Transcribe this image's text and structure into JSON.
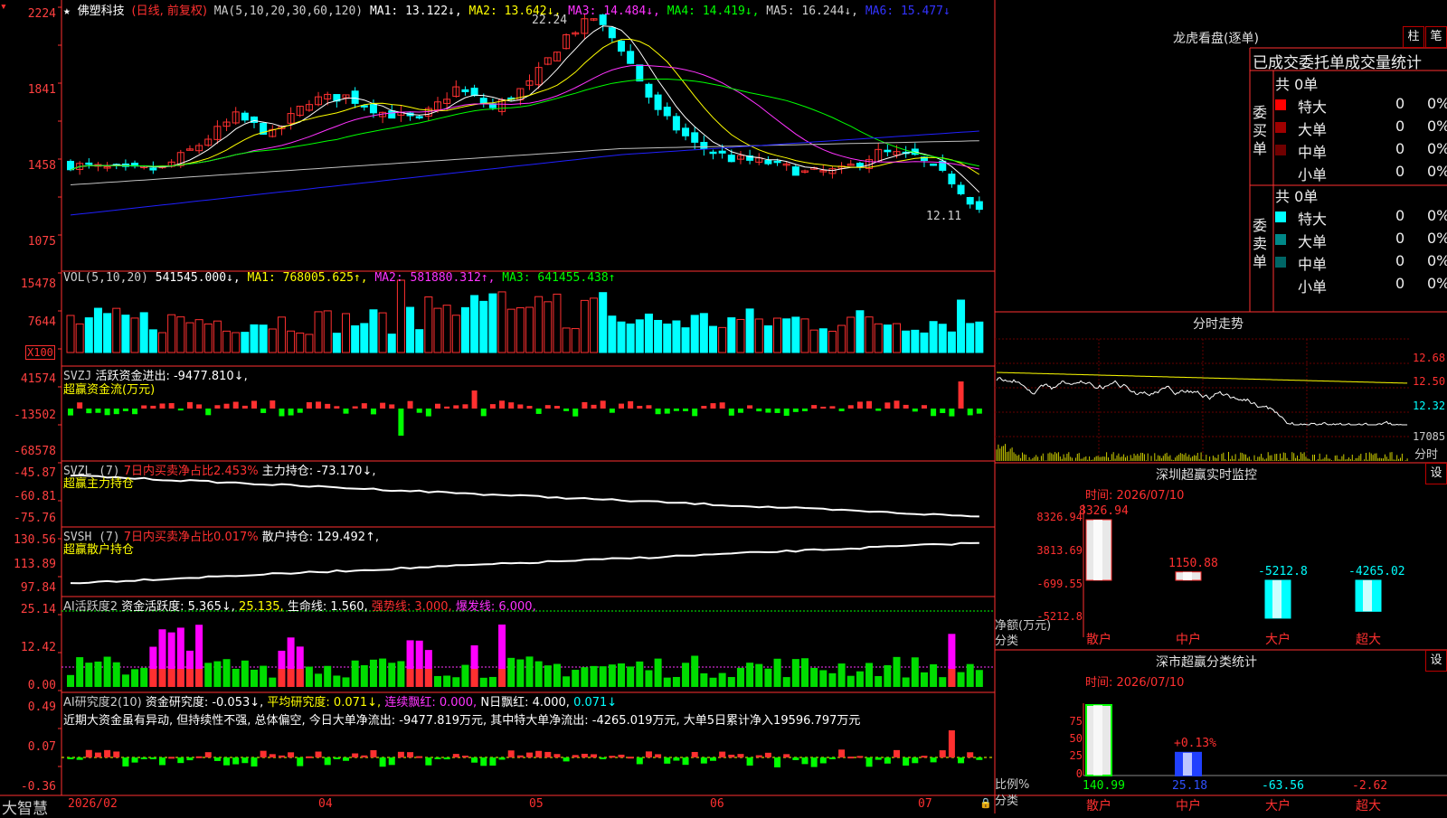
{
  "colors": {
    "up": "#ff3030",
    "down": "#00ffff",
    "ma1": "#ffffff",
    "ma2": "#ffff00",
    "ma3": "#ff33ff",
    "ma4": "#00ff00",
    "ma5": "#c0c0c0",
    "ma6": "#2020ff",
    "axis": "#ff3030",
    "bg": "#000000"
  },
  "header": {
    "star": "★",
    "stock": "佛塑科技",
    "mode": "(日线, 前复权)",
    "ma_label": "MA(5,10,20,30,60,120)",
    "ma1": "MA1: 13.122↓,",
    "ma2": "MA2: 13.642↓,",
    "ma3": "MA3: 14.484↓,",
    "ma4": "MA4: 14.419↓,",
    "ma5": "MA5: 16.244↓,",
    "ma6": "MA6: 15.477↓"
  },
  "main_axis": {
    "labels": [
      "2224",
      "1841",
      "1458",
      "1075"
    ],
    "high_mark": "22.24",
    "low_mark": "12.11"
  },
  "volume": {
    "title": "VOL(5,10,20)",
    "value": "541545.000↓,",
    "ma1": "MA1: 768005.625↑,",
    "ma2": "MA2: 581880.312↑,",
    "ma3": "MA3: 641455.438↑",
    "axis": [
      "15478",
      "7644"
    ],
    "unit": "X100"
  },
  "svzj": {
    "title": "SVZJ",
    "label": "活跃资金进出: -9477.810↓,",
    "sub": "超赢资金流(万元)",
    "axis": [
      "41574",
      "-13502",
      "-68578"
    ]
  },
  "svzl": {
    "title": "SVZL (7)",
    "ratio": "7日内买卖净占比2.453%",
    "hold": "主力持仓: -73.170↓,",
    "sub": "超赢主力持仓",
    "axis": [
      "-45.87",
      "-60.81",
      "-75.76"
    ]
  },
  "svsh": {
    "title": "SVSH (7)",
    "ratio": "7日内买卖净占比0.017%",
    "hold": "散户持仓: 129.492↑,",
    "sub": "超赢散户持仓",
    "axis": [
      "130.56",
      "113.89",
      "97.84"
    ]
  },
  "ai_act": {
    "title": "AI活跃度2",
    "act": "资金活跃度: 5.365↓,",
    "v2": "25.135,",
    "life": "生命线: 1.560,",
    "strong": "强势线: 3.000,",
    "burst": "爆发线: 6.000,",
    "axis": [
      "25.14",
      "12.42",
      "0.00"
    ]
  },
  "ai_res": {
    "title": "AI研究度2(10)",
    "res": "资金研究度: -0.053↓,",
    "avg": "平均研究度: 0.071↓,",
    "cont": "连续飘红: 0.000,",
    "n": "N日飘红: 4.000,",
    "last": "0.071↓",
    "axis": [
      "0.49",
      "0.07",
      "-0.36"
    ],
    "comment": "近期大资金虽有异动, 但持续性不强, 总体偏空, 今日大单净流出: -9477.819万元, 其中特大单净流出: -4265.019万元, 大单5日累计净入19596.797万元"
  },
  "bottom": {
    "brand": "大智慧",
    "dates": [
      "2026/02",
      "04",
      "05",
      "06",
      "07"
    ]
  },
  "lhb": {
    "title": "龙虎看盘(逐单)",
    "btn1": "柱",
    "btn2": "笔",
    "sub": "已成交委托单成交量统计",
    "buy_label": "委买单",
    "sell_label": "委卖单",
    "buy_total": "共 0单",
    "sell_total": "共 0单",
    "rows_buy": [
      {
        "name": "特大",
        "v": "0",
        "p": "0%",
        "c": "#ff0000"
      },
      {
        "name": "大单",
        "v": "0",
        "p": "0%",
        "c": "#a00000"
      },
      {
        "name": "中单",
        "v": "0",
        "p": "0%",
        "c": "#700000"
      },
      {
        "name": "小单",
        "v": "0",
        "p": "0%",
        "c": "#000000"
      }
    ],
    "rows_sell": [
      {
        "name": "特大",
        "v": "0",
        "p": "0%",
        "c": "#00ffff"
      },
      {
        "name": "大单",
        "v": "0",
        "p": "0%",
        "c": "#008888"
      },
      {
        "name": "中单",
        "v": "0",
        "p": "0%",
        "c": "#006666"
      },
      {
        "name": "小单",
        "v": "0",
        "p": "0%",
        "c": "#000000"
      }
    ]
  },
  "intraday": {
    "title": "分时走势",
    "axis": [
      "12.68",
      "12.50",
      "12.32"
    ],
    "vol": "17085",
    "vol_unit": "分时"
  },
  "sz_monitor": {
    "title": "深圳超赢实时监控",
    "btn": "设",
    "time": "时间: 2026/07/10",
    "axis": [
      "8326.94",
      "3813.69",
      "-699.55",
      "-5212.8"
    ],
    "bars": [
      {
        "cat": "散户",
        "v": 8326.94,
        "lbl": "8326.94"
      },
      {
        "cat": "中户",
        "v": 1150.88,
        "lbl": "1150.88"
      },
      {
        "cat": "大户",
        "v": -5212.8,
        "lbl": "-5212.8"
      },
      {
        "cat": "超大",
        "v": -4265.02,
        "lbl": "-4265.02"
      }
    ],
    "ylabel": "净额(万元)",
    "xlabel": "分类"
  },
  "sz_class": {
    "title": "深市超赢分类统计",
    "btn": "设",
    "time": "时间: 2026/07/10",
    "axis": [
      "75",
      "50",
      "25",
      "0"
    ],
    "bars": [
      {
        "cat": "散户",
        "v": 140.99,
        "lbl": "140.99"
      },
      {
        "cat": "中户",
        "v": 25.18,
        "lbl": "25.18",
        "top": "+0.13%"
      },
      {
        "cat": "大户",
        "v": -63.56,
        "lbl": "-63.56"
      },
      {
        "cat": "超大",
        "v": -2.62,
        "lbl": "-2.62"
      }
    ],
    "ylabel": "比例%",
    "xlabel": "分类"
  }
}
